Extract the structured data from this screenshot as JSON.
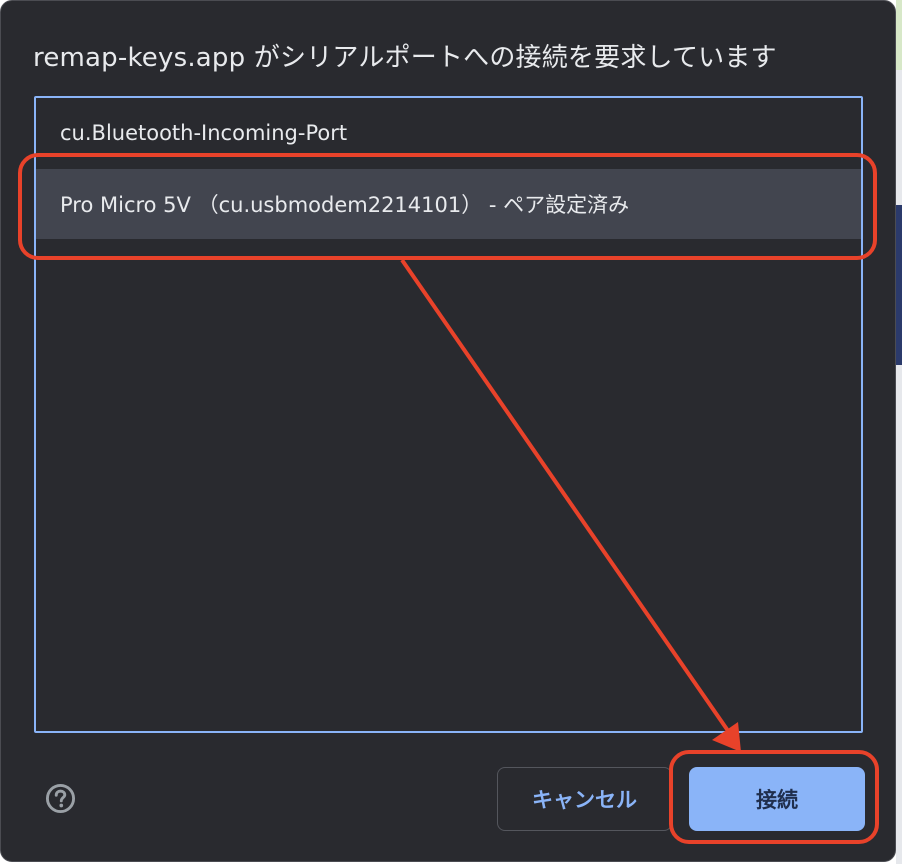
{
  "dialog": {
    "title": "remap-keys.app がシリアルポートへの接続を要求しています"
  },
  "port_list": {
    "items": [
      {
        "label": "cu.Bluetooth-Incoming-Port",
        "selected": false
      },
      {
        "label": "Pro Micro 5V （cu.usbmodem2214101） - ペア設定済み",
        "selected": true
      }
    ]
  },
  "footer": {
    "help_icon": "help-circle-icon",
    "cancel_label": "キャンセル",
    "connect_label": "接続"
  },
  "annotations": {
    "highlight_color": "#e8422a"
  }
}
